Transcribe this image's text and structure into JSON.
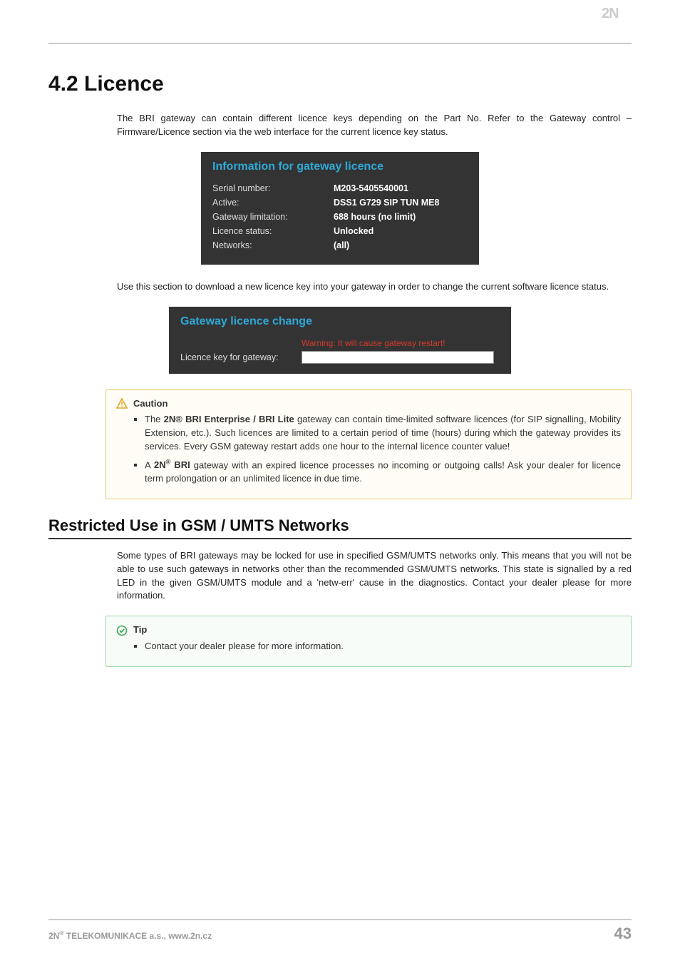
{
  "logo_text": "2N",
  "section_title": "4.2 Licence",
  "intro_para": "The BRI gateway can contain different licence keys depending on the Part No. Refer to the Gateway control – Firmware/Licence section via the web interface for the current licence key status.",
  "info_panel": {
    "title": "Information for gateway licence",
    "rows": [
      {
        "label": "Serial number:",
        "value": "M203-5405540001"
      },
      {
        "label": "Active:",
        "value": "DSS1 G729 SIP TUN ME8"
      },
      {
        "label": "Gateway limitation:",
        "value": "688 hours (no limit)"
      },
      {
        "label": "Licence status:",
        "value": "Unlocked"
      },
      {
        "label": "Networks:",
        "value": "(all)"
      }
    ]
  },
  "mid_para": "Use this section to download a new licence key into your gateway in order to change the current software licence status.",
  "change_panel": {
    "title": "Gateway licence change",
    "warning": "Warning: It will cause gateway restart!",
    "input_label": "Licence key for gateway:",
    "input_value": ""
  },
  "caution": {
    "title": "Caution",
    "item1_prefix": "The ",
    "item1_bold": "2N® BRI Enterprise / BRI Lite",
    "item1_rest": " gateway can contain time-limited software licences (for SIP signalling, Mobility Extension, etc.). Such licences are limited to a certain period of time (hours) during which the gateway provides its services. Every GSM gateway restart adds one hour to the internal licence counter value!",
    "item2_prefix": "A ",
    "item2_bold_a": "2N",
    "item2_bold_sup": "®",
    "item2_bold_b": " BRI",
    "item2_rest": " gateway with an expired licence processes no incoming or outgoing calls! Ask your dealer for licence term prolongation or an unlimited licence in due time."
  },
  "subsection_title": "Restricted Use in GSM / UMTS Networks",
  "sub_para": "Some types of BRI gateways may be locked for use in specified GSM/UMTS networks only. This means that you will not be able to use such gateways in networks other than the recommended GSM/UMTS networks. This state is signalled by a red LED in the given GSM/UMTS module and a 'netw-err' cause in the diagnostics. Contact your dealer please for more information.",
  "tip": {
    "title": "Tip",
    "item": "Contact your dealer please for more information."
  },
  "footer": {
    "left_a": "2N",
    "left_sup": "®",
    "left_b": " TELEKOMUNIKACE a.s., www.2n.cz",
    "page": "43"
  },
  "icons": {
    "warn": "warning-triangle-icon",
    "tip": "check-circle-icon",
    "logo": "2n-logo"
  },
  "colors": {
    "panel_bg": "#333333",
    "panel_title": "#2fa8d6",
    "warning_text": "#d43a2f",
    "caution_border": "#e6c96f",
    "tip_border": "#9fd7a8",
    "footer_grey": "#999999"
  }
}
